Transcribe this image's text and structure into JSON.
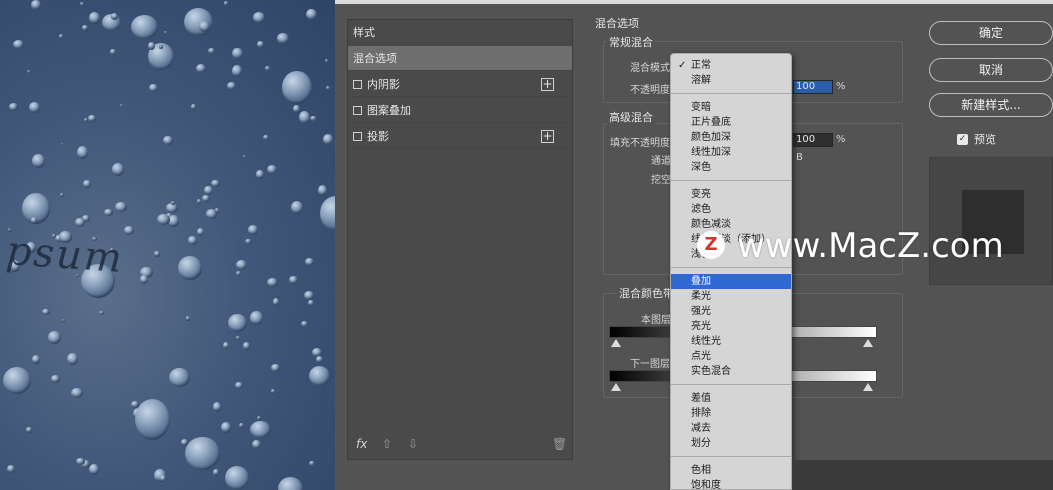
{
  "canvas": {
    "text": "psum"
  },
  "style_list": {
    "header": "样式",
    "items": [
      {
        "label": "混合选项",
        "has_checkbox": false,
        "has_plus": false,
        "selected": true
      },
      {
        "label": "内阴影",
        "has_checkbox": true,
        "has_plus": true,
        "selected": false
      },
      {
        "label": "图案叠加",
        "has_checkbox": true,
        "has_plus": false,
        "selected": false
      },
      {
        "label": "投影",
        "has_checkbox": true,
        "has_plus": true,
        "selected": false
      }
    ],
    "footer": {
      "fx_icon": "fx",
      "up_icon": "⇧",
      "down_icon": "⇩",
      "trash_icon": "🗑"
    }
  },
  "settings": {
    "title": "混合选项",
    "general": {
      "title": "常规混合",
      "mode_label": "混合模式",
      "opacity_label": "不透明度",
      "opacity_value": "100",
      "percent": "%"
    },
    "advanced": {
      "title": "高级混合",
      "fill_label": "填充不透明度",
      "fill_value": "100",
      "percent": "%",
      "channels_label": "通道",
      "channel_b": "B",
      "knockout_label": "挖空"
    },
    "blend_if": {
      "title": "混合颜色带",
      "this_layer": "本图层",
      "underlying": "下一图层"
    }
  },
  "buttons": {
    "ok": "确定",
    "cancel": "取消",
    "new_style": "新建样式..."
  },
  "preview": {
    "label": "预览",
    "checked": true
  },
  "blend_menu": {
    "selected": "正常",
    "highlighted": "叠加",
    "groups": [
      [
        "正常",
        "溶解"
      ],
      [
        "变暗",
        "正片叠底",
        "颜色加深",
        "线性加深",
        "深色"
      ],
      [
        "变亮",
        "滤色",
        "颜色减淡",
        "线性减淡（添加）",
        "浅色"
      ],
      [
        "叠加",
        "柔光",
        "强光",
        "亮光",
        "线性光",
        "点光",
        "实色混合"
      ],
      [
        "差值",
        "排除",
        "减去",
        "划分"
      ],
      [
        "色相",
        "饱和度"
      ]
    ]
  },
  "watermark": {
    "logo": "Z",
    "text": "www.MacZ.com"
  },
  "colors": {
    "dialog": "#535353",
    "menu": "#d5d5d5",
    "highlight": "#2f67d3"
  }
}
